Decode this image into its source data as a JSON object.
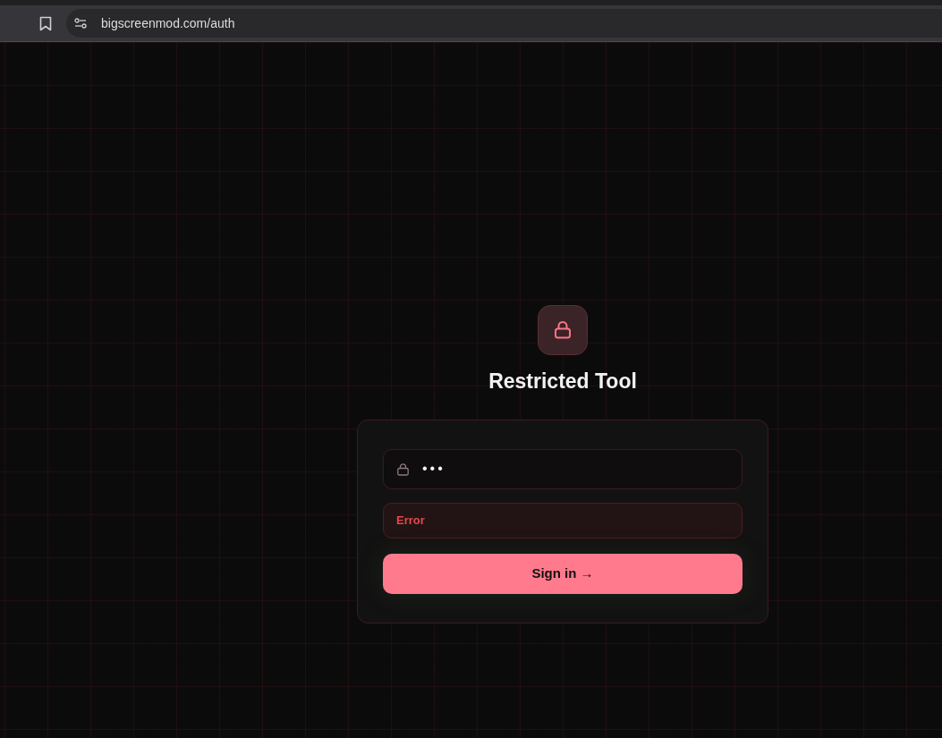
{
  "browser": {
    "url": "bigscreenmod.com/auth"
  },
  "header": {
    "title": "Restricted Tool"
  },
  "form": {
    "password": {
      "value": "•••"
    },
    "error": "Error",
    "submit": "Sign in →"
  }
}
